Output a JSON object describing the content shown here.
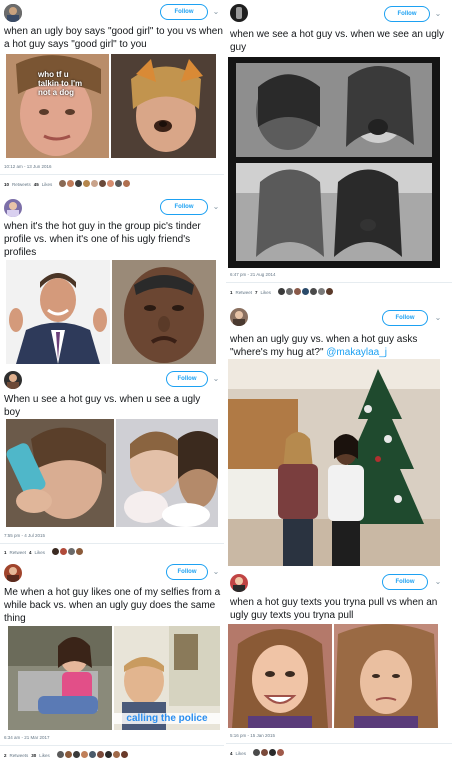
{
  "ui": {
    "follow_label": "Follow"
  },
  "tweets": [
    {
      "caption": "when an ugly boy says \"good girl\" to you vs when a hot guy says \"good girl\" to you",
      "photo_overlay": "who tf u talkin to I'm not a dog",
      "timestamp": "10:12 am - 13 Jun 2016",
      "retweets": "10",
      "retweets_label": "Retweets",
      "likes": "45",
      "likes_label": "Likes"
    },
    {
      "caption": "when we see a hot guy vs. when we see an ugly guy",
      "timestamp": "6:47 pm - 21 Aug 2014",
      "retweets": "1",
      "retweets_label": "Retweet",
      "likes": "7",
      "likes_label": "Likes"
    },
    {
      "caption": "when it's the hot guy in the group pic's tinder profile vs. when it's one of his ugly friend's profiles"
    },
    {
      "caption_prefix": "when an ugly guy vs. when a hot guy asks \"where's my hug at?\" ",
      "mention": "@makaylaa_j"
    },
    {
      "caption": "When u see a hot guy vs. when u see a ugly boy",
      "timestamp": "7:55 pm - 4 Jul 2015",
      "retweets": "1",
      "retweets_label": "Retweet",
      "likes": "4",
      "likes_label": "Likes"
    },
    {
      "caption": "Me when a hot guy likes one of my selfies from a while back vs. when an ugly guy does the same thing",
      "photo_overlay": "calling the police",
      "timestamp": "6:34 am - 21 Mar 2017",
      "retweets": "2",
      "retweets_label": "Retweets",
      "likes": "30",
      "likes_label": "Likes"
    },
    {
      "caption": "when a hot guy texts you tryna pull vs when an ugly guy texts you tryna pull",
      "timestamp": "5:16 pm - 15 Jan 2015",
      "likes": "4",
      "likes_label": "Likes"
    }
  ],
  "colors": {
    "accent": "#1da1f2",
    "meta_text": "#657786",
    "divider": "#e6ecf0"
  }
}
